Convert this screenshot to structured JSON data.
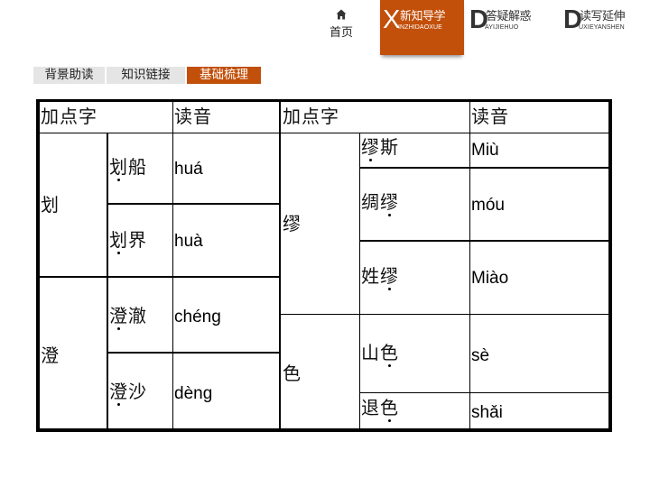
{
  "nav": {
    "home": {
      "icon": "home-icon",
      "label": "首页"
    },
    "sections": [
      {
        "letter": "X",
        "title": "新知导学",
        "subtitle": "INZHIDAOXUE",
        "active": true
      },
      {
        "letter": "D",
        "title": "答疑解惑",
        "subtitle": "AYIJIEHUO",
        "active": false
      },
      {
        "letter": "D",
        "title": "读写延伸",
        "subtitle": "UXIEYANSHEN",
        "active": false
      }
    ]
  },
  "tabs": [
    {
      "label": "背景助读",
      "active": false
    },
    {
      "label": "知识链接",
      "active": false
    },
    {
      "label": "基础梳理",
      "active": true
    }
  ],
  "colors": {
    "accent": "#c24f0a",
    "tab_bg": "#e5e5e5",
    "grid": "#000000"
  },
  "table": {
    "headers": [
      "加点字",
      "读音",
      "加点字",
      "读音"
    ],
    "left": [
      {
        "char": "划",
        "words": [
          {
            "chars": [
              "划",
              "船"
            ],
            "dot": 0,
            "pinyin": "huá"
          },
          {
            "chars": [
              "划",
              "界"
            ],
            "dot": 0,
            "pinyin": "huà"
          }
        ]
      },
      {
        "char": "澄",
        "words": [
          {
            "chars": [
              "澄",
              "澈"
            ],
            "dot": 0,
            "pinyin": "chéng"
          },
          {
            "chars": [
              "澄",
              "沙"
            ],
            "dot": 0,
            "pinyin": "dèng"
          }
        ]
      }
    ],
    "right": [
      {
        "char": "缪",
        "words": [
          {
            "chars": [
              "缪",
              "斯"
            ],
            "dot": 0,
            "pinyin": "Miù"
          },
          {
            "chars": [
              "绸",
              "缪"
            ],
            "dot": 1,
            "pinyin": "móu"
          },
          {
            "chars": [
              "姓",
              "缪"
            ],
            "dot": 1,
            "pinyin": "Miào"
          }
        ]
      },
      {
        "char": "色",
        "words": [
          {
            "chars": [
              "山",
              "色"
            ],
            "dot": 1,
            "pinyin": "sè"
          },
          {
            "chars": [
              "退",
              "色"
            ],
            "dot": 1,
            "pinyin": "shǎi"
          }
        ]
      }
    ]
  }
}
